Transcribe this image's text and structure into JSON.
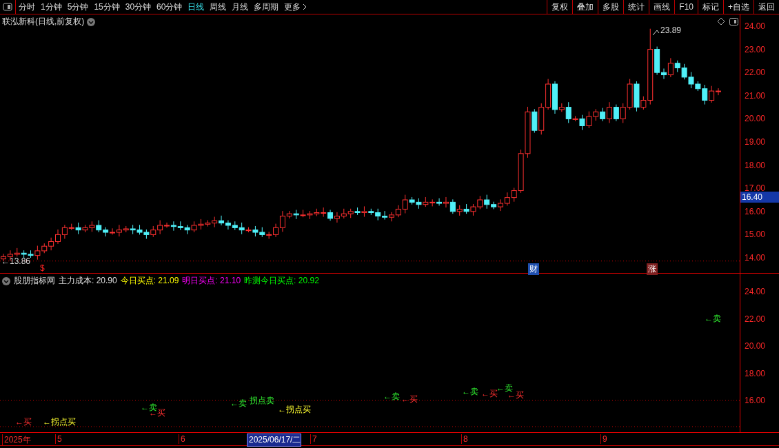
{
  "toolbar": {
    "periods": [
      {
        "label": "分时",
        "selected": false
      },
      {
        "label": "1分钟",
        "selected": false
      },
      {
        "label": "5分钟",
        "selected": false
      },
      {
        "label": "15分钟",
        "selected": false
      },
      {
        "label": "30分钟",
        "selected": false
      },
      {
        "label": "60分钟",
        "selected": false
      },
      {
        "label": "日线",
        "selected": true
      },
      {
        "label": "周线",
        "selected": false
      },
      {
        "label": "月线",
        "selected": false
      },
      {
        "label": "多周期",
        "selected": false
      }
    ],
    "more": "更多",
    "buttons": [
      "复权",
      "叠加",
      "多股",
      "统计",
      "画线",
      "F10",
      "标记",
      "+自选",
      "返回"
    ]
  },
  "price_chart": {
    "title": "联泓新科(日线,前复权)",
    "high_label": "23.89",
    "low_label": "←13.86",
    "current_price": "16.40",
    "axis_labels": [
      "24.00",
      "23.00",
      "22.00",
      "21.00",
      "20.00",
      "19.00",
      "18.00",
      "17.00",
      "16.00",
      "15.00",
      "14.00"
    ],
    "markers": [
      {
        "text": "$",
        "kind": "dividend"
      },
      {
        "text": "财",
        "kind": "finance"
      },
      {
        "text": "涨",
        "kind": "limit"
      }
    ]
  },
  "indicator": {
    "name": "股朋指标网",
    "values": [
      {
        "text": "主力成本: 20.90",
        "color": "#e0e0e0"
      },
      {
        "text": "今日买点: 21.09",
        "color": "#ffff00"
      },
      {
        "text": "明日买点: 21.10",
        "color": "#ff00ff"
      },
      {
        "text": "昨测今日买点: 20.92",
        "color": "#00ff00"
      }
    ],
    "axis_labels": [
      "24.00",
      "22.00",
      "20.00",
      "18.00",
      "16.00"
    ],
    "signals": [
      {
        "text": "←买",
        "kind": "buy"
      },
      {
        "text": "←拐点买",
        "kind": "turn_buy"
      },
      {
        "text": "←卖",
        "kind": "sell"
      },
      {
        "text": "←买",
        "kind": "buy"
      },
      {
        "text": "←卖",
        "kind": "sell"
      },
      {
        "text": "拐点卖",
        "kind": "turn_sell"
      },
      {
        "text": "←拐点买",
        "kind": "turn_buy"
      },
      {
        "text": "←卖",
        "kind": "sell"
      },
      {
        "text": "←买",
        "kind": "buy"
      },
      {
        "text": "←卖",
        "kind": "sell"
      },
      {
        "text": "←买",
        "kind": "buy"
      },
      {
        "text": "←卖",
        "kind": "sell"
      },
      {
        "text": "←买",
        "kind": "buy"
      },
      {
        "text": "←卖",
        "kind": "sell"
      }
    ]
  },
  "date_axis": [
    {
      "text": "2025年",
      "selected": false
    },
    {
      "text": "5",
      "selected": false
    },
    {
      "text": "6",
      "selected": false
    },
    {
      "text": "2025/06/17/二",
      "selected": true
    },
    {
      "text": "7",
      "selected": false
    },
    {
      "text": "8",
      "selected": false
    },
    {
      "text": "9",
      "selected": false
    }
  ]
}
